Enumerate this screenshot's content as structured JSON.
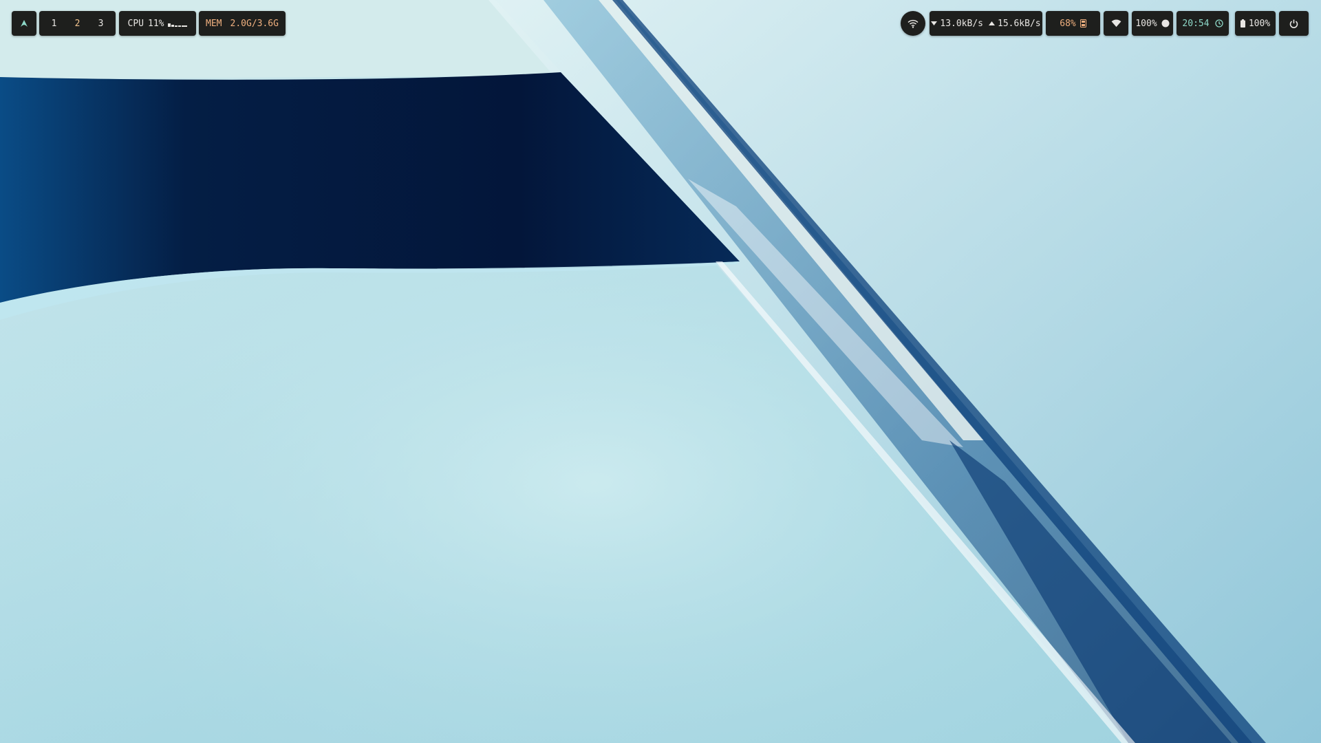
{
  "workspaces": {
    "launcher_icon": "arch-logo-icon",
    "items": [
      {
        "label": "1",
        "active": false
      },
      {
        "label": "2",
        "active": true
      },
      {
        "label": "3",
        "active": false
      }
    ]
  },
  "cpu": {
    "label": "CPU",
    "value": "11%",
    "graph_icon": "cpu-usage-sparkline"
  },
  "memory": {
    "label": "MEM",
    "value": "2.0G/3.6G"
  },
  "network": {
    "icon": "wifi-icon",
    "download": "13.0kB/s",
    "upload": "15.6kB/s"
  },
  "disk": {
    "value": "68%",
    "icon": "disk-icon"
  },
  "wifi_status": {
    "icon": "wifi-icon"
  },
  "volume": {
    "value": "100%",
    "icon": "volume-dot-icon"
  },
  "clock": {
    "time": "20:54",
    "icon": "clock-icon"
  },
  "battery": {
    "value": "100%",
    "icon": "battery-icon"
  },
  "power": {
    "icon": "power-icon"
  },
  "colors": {
    "bar_background": "#1e1f1d",
    "accent_orange": "#f0b07f",
    "accent_teal": "#8ed9c9",
    "text": "#e8e6e3"
  }
}
